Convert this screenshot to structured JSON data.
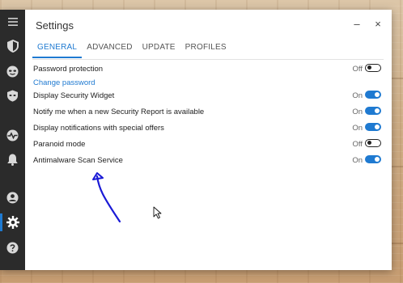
{
  "window": {
    "title": "Settings",
    "minimize_label": "–",
    "close_label": "×"
  },
  "sidebar": {
    "items": [
      {
        "name": "menu-icon"
      },
      {
        "name": "shield-icon"
      },
      {
        "name": "mask-icon"
      },
      {
        "name": "privacy-icon"
      },
      {
        "name": "activity-icon"
      },
      {
        "name": "bell-icon"
      },
      {
        "name": "account-icon"
      },
      {
        "name": "gear-icon",
        "active": true
      },
      {
        "name": "help-icon"
      }
    ]
  },
  "tabs": [
    {
      "label": "GENERAL",
      "active": true
    },
    {
      "label": "ADVANCED"
    },
    {
      "label": "UPDATE"
    },
    {
      "label": "PROFILES"
    }
  ],
  "settings": {
    "password_protection": {
      "label": "Password protection",
      "state": "Off",
      "on": false
    },
    "change_password": "Change password",
    "security_widget": {
      "label": "Display Security Widget",
      "state": "On",
      "on": true
    },
    "security_report": {
      "label": "Notify me when a new Security Report is available",
      "state": "On",
      "on": true
    },
    "special_offers": {
      "label": "Display notifications with special offers",
      "state": "On",
      "on": true
    },
    "paranoid_mode": {
      "label": "Paranoid mode",
      "state": "Off",
      "on": false
    },
    "antimalware": {
      "label": "Antimalware Scan Service",
      "state": "On",
      "on": true
    }
  },
  "colors": {
    "accent": "#1f7ad1",
    "sidebar": "#2b2b2b",
    "annotation": "#1a1ad6"
  }
}
